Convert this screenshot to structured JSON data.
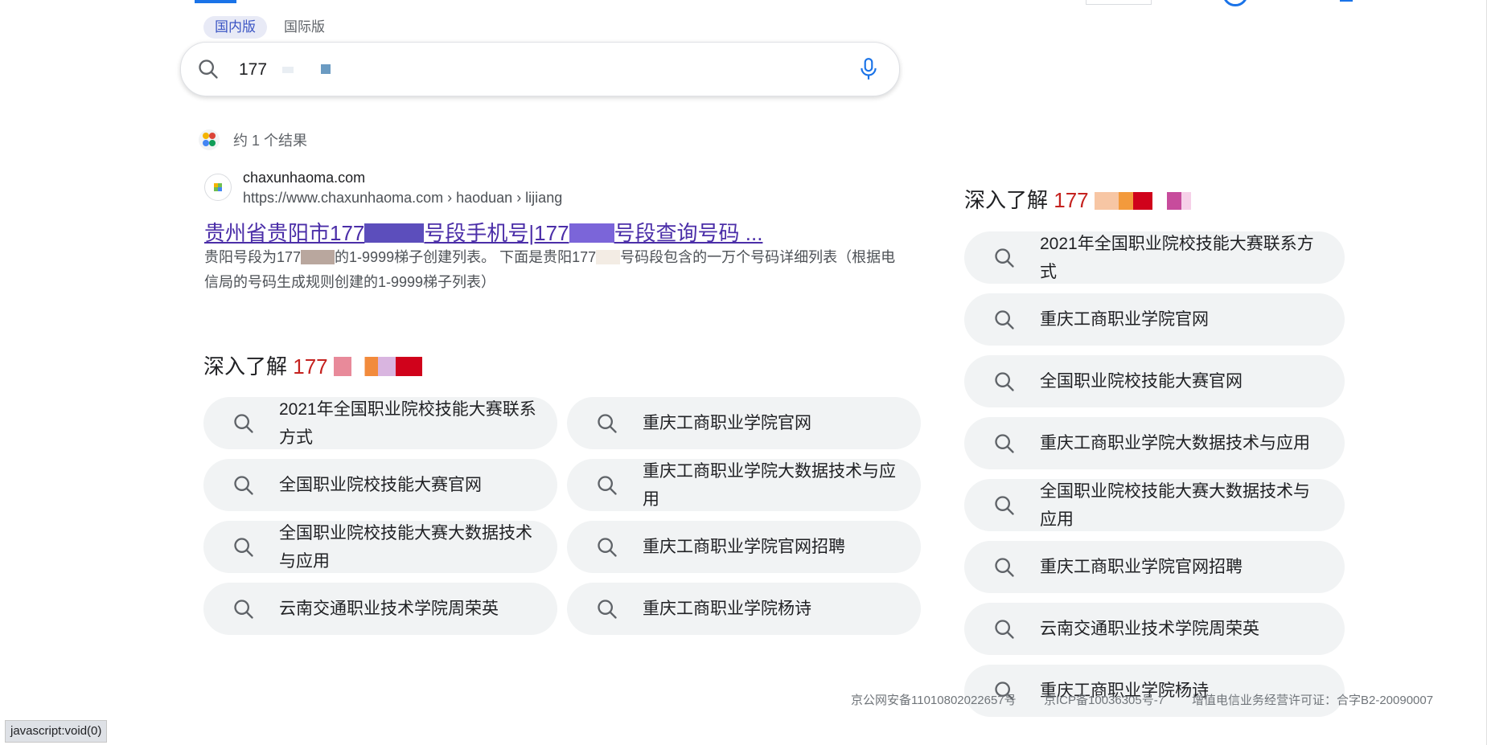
{
  "versions": [
    "国内版",
    "国际版"
  ],
  "search": {
    "value": "177"
  },
  "results_count": "约 1 个结果",
  "result": {
    "site_name": "chaxunhaoma.com",
    "url": "https://www.chaxunhaoma.com › haoduan › lijiang",
    "title_a": "贵州省贵阳市177",
    "title_b": "号段手机号|177",
    "title_c": "号段查询号码 ...",
    "snippet_a": "贵阳号段为177",
    "snippet_b": "的1-9999梯子创建列表。 下面是贵阳177",
    "snippet_c": "号码段包含的一万个号码详细列表（根据电信局的号码生成规则创建的1-9999梯子列表）"
  },
  "explore_main": {
    "heading": "深入了解",
    "query": "177",
    "chips": [
      "2021年全国职业院校技能大赛联系方式",
      "重庆工商职业学院官网",
      "全国职业院校技能大赛官网",
      "重庆工商职业学院大数据技术与应用",
      "全国职业院校技能大赛大数据技术与应用",
      "重庆工商职业学院官网招聘",
      "云南交通职业技术学院周荣英",
      "重庆工商职业学院杨诗"
    ]
  },
  "explore_side": {
    "heading": "深入了解",
    "query": "177",
    "chips": [
      "2021年全国职业院校技能大赛联系方式",
      "重庆工商职业学院官网",
      "全国职业院校技能大赛官网",
      "重庆工商职业学院大数据技术与应用",
      "全国职业院校技能大赛大数据技术与应用",
      "重庆工商职业学院官网招聘",
      "云南交通职业技术学院周荣英",
      "重庆工商职业学院杨诗"
    ]
  },
  "footer": {
    "beian": "京公网安备11010802022657号",
    "icp": "京ICP备10036305号-7",
    "license": "增值电信业务经营许可证：合字B2-20090007"
  },
  "status_bar": "javascript:void(0)",
  "icons": {
    "search": "search-icon",
    "mic": "microphone-icon",
    "results": "results-info-icon",
    "favicon": "site-favicon"
  },
  "colors": {
    "accent": "#1a73e8",
    "query_red": "#c5221f",
    "title_link": "#4b2ea8",
    "chip_bg": "#f1f3f4"
  }
}
